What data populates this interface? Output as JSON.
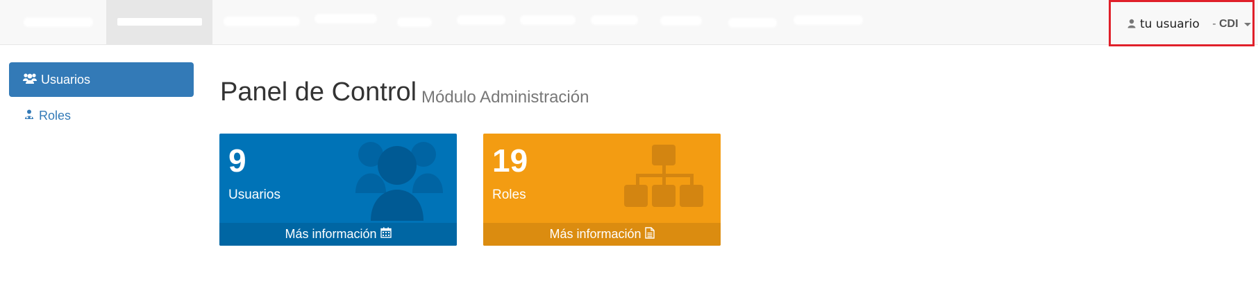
{
  "navbar": {
    "user_name": "tu usuario",
    "org_prefix": " - ",
    "org_name": "CDI"
  },
  "sidebar": {
    "items": [
      {
        "label": "Usuarios",
        "icon": "users-icon",
        "active": true
      },
      {
        "label": "Roles",
        "icon": "user-role-icon",
        "active": false
      }
    ]
  },
  "header": {
    "title": "Panel de Control",
    "subtitle": "Módulo Administración"
  },
  "boxes": [
    {
      "count": "9",
      "label": "Usuarios",
      "footer": "Más información",
      "footer_icon": "calendar-icon",
      "bg_icon": "users-icon",
      "color": "#0073b7"
    },
    {
      "count": "19",
      "label": "Roles",
      "footer": "Más información",
      "footer_icon": "file-text-icon",
      "bg_icon": "sitemap-icon",
      "color": "#f39c12"
    }
  ],
  "colors": {
    "primary": "#337ab7",
    "highlight_border": "#e0202a"
  }
}
